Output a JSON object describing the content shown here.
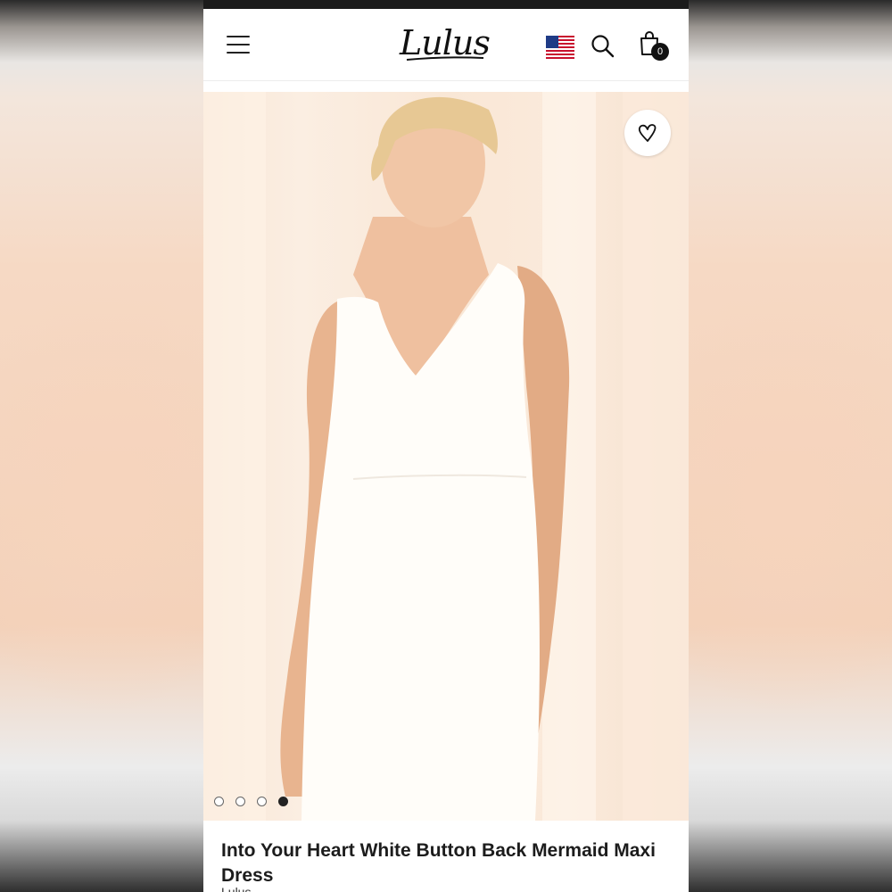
{
  "header": {
    "logo_text": "Lulus",
    "menu_icon": "hamburger-menu-icon",
    "flag_icon": "us-flag-icon",
    "search_icon": "search-icon",
    "bag_icon": "shopping-bag-icon",
    "bag_count": "0"
  },
  "gallery": {
    "image_alt": "Model wearing white sleeveless V-neck maxi dress",
    "favorite_icon": "heart-icon",
    "slide_count": 4,
    "active_slide": 4
  },
  "product": {
    "title": "Into Your Heart White Button Back Mermaid Maxi Dress",
    "brand": "Lulus"
  },
  "colors": {
    "text": "#1c1c1c",
    "background": "#ffffff",
    "accent_dark": "#111111"
  }
}
